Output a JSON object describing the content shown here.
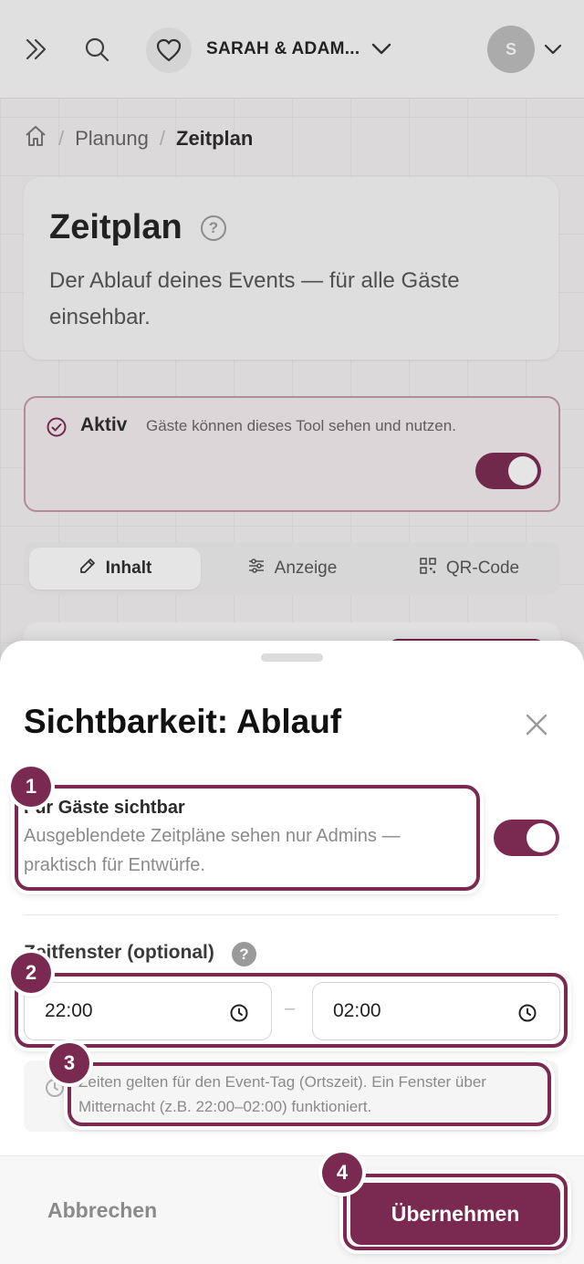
{
  "topbar": {
    "event_name": "SARAH & ADAM...",
    "avatar_initial": "S"
  },
  "breadcrumb": {
    "items": [
      "Planung",
      "Zeitplan"
    ]
  },
  "page": {
    "title": "Zeitplan",
    "help": "?",
    "description": "Der Ablauf deines Events — für alle Gäste einsehbar."
  },
  "active_card": {
    "label": "Aktiv",
    "description": "Gäste können dieses Tool sehen und nutzen.",
    "toggle_on": true
  },
  "tabs": [
    {
      "label": "Inhalt",
      "icon": "edit-icon",
      "active": true
    },
    {
      "label": "Anzeige",
      "icon": "sliders-icon",
      "active": false
    },
    {
      "label": "QR-Code",
      "icon": "qr-code-icon",
      "active": false
    }
  ],
  "sheet": {
    "title": "Sichtbarkeit: Ablauf",
    "visibility": {
      "title": "Für Gäste sichtbar",
      "description": "Ausgeblendete Zeitpläne sehen nur Admins — praktisch für Entwürfe.",
      "toggle_on": true
    },
    "time_window": {
      "label": "Zeitfenster (optional)",
      "help": "?",
      "start": "22:00",
      "separator": "–",
      "end": "02:00"
    },
    "note": "Zeiten gelten für den Event-Tag (Ortszeit). Ein Fenster über Mitternacht (z.B. 22:00–02:00) funktioniert.",
    "cancel_label": "Abbrechen",
    "apply_label": "Übernehmen"
  },
  "annotations": [
    "1",
    "2",
    "3",
    "4"
  ],
  "colors": {
    "accent": "#7a2a50",
    "active_card_bg": "#f6eef1"
  }
}
